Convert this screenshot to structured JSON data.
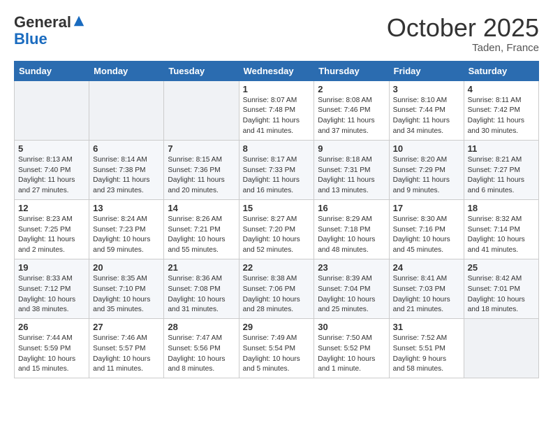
{
  "header": {
    "logo_line1": "General",
    "logo_line2": "Blue",
    "month": "October 2025",
    "location": "Taden, France"
  },
  "weekdays": [
    "Sunday",
    "Monday",
    "Tuesday",
    "Wednesday",
    "Thursday",
    "Friday",
    "Saturday"
  ],
  "weeks": [
    [
      {
        "day": "",
        "info": ""
      },
      {
        "day": "",
        "info": ""
      },
      {
        "day": "",
        "info": ""
      },
      {
        "day": "1",
        "info": "Sunrise: 8:07 AM\nSunset: 7:48 PM\nDaylight: 11 hours\nand 41 minutes."
      },
      {
        "day": "2",
        "info": "Sunrise: 8:08 AM\nSunset: 7:46 PM\nDaylight: 11 hours\nand 37 minutes."
      },
      {
        "day": "3",
        "info": "Sunrise: 8:10 AM\nSunset: 7:44 PM\nDaylight: 11 hours\nand 34 minutes."
      },
      {
        "day": "4",
        "info": "Sunrise: 8:11 AM\nSunset: 7:42 PM\nDaylight: 11 hours\nand 30 minutes."
      }
    ],
    [
      {
        "day": "5",
        "info": "Sunrise: 8:13 AM\nSunset: 7:40 PM\nDaylight: 11 hours\nand 27 minutes."
      },
      {
        "day": "6",
        "info": "Sunrise: 8:14 AM\nSunset: 7:38 PM\nDaylight: 11 hours\nand 23 minutes."
      },
      {
        "day": "7",
        "info": "Sunrise: 8:15 AM\nSunset: 7:36 PM\nDaylight: 11 hours\nand 20 minutes."
      },
      {
        "day": "8",
        "info": "Sunrise: 8:17 AM\nSunset: 7:33 PM\nDaylight: 11 hours\nand 16 minutes."
      },
      {
        "day": "9",
        "info": "Sunrise: 8:18 AM\nSunset: 7:31 PM\nDaylight: 11 hours\nand 13 minutes."
      },
      {
        "day": "10",
        "info": "Sunrise: 8:20 AM\nSunset: 7:29 PM\nDaylight: 11 hours\nand 9 minutes."
      },
      {
        "day": "11",
        "info": "Sunrise: 8:21 AM\nSunset: 7:27 PM\nDaylight: 11 hours\nand 6 minutes."
      }
    ],
    [
      {
        "day": "12",
        "info": "Sunrise: 8:23 AM\nSunset: 7:25 PM\nDaylight: 11 hours\nand 2 minutes."
      },
      {
        "day": "13",
        "info": "Sunrise: 8:24 AM\nSunset: 7:23 PM\nDaylight: 10 hours\nand 59 minutes."
      },
      {
        "day": "14",
        "info": "Sunrise: 8:26 AM\nSunset: 7:21 PM\nDaylight: 10 hours\nand 55 minutes."
      },
      {
        "day": "15",
        "info": "Sunrise: 8:27 AM\nSunset: 7:20 PM\nDaylight: 10 hours\nand 52 minutes."
      },
      {
        "day": "16",
        "info": "Sunrise: 8:29 AM\nSunset: 7:18 PM\nDaylight: 10 hours\nand 48 minutes."
      },
      {
        "day": "17",
        "info": "Sunrise: 8:30 AM\nSunset: 7:16 PM\nDaylight: 10 hours\nand 45 minutes."
      },
      {
        "day": "18",
        "info": "Sunrise: 8:32 AM\nSunset: 7:14 PM\nDaylight: 10 hours\nand 41 minutes."
      }
    ],
    [
      {
        "day": "19",
        "info": "Sunrise: 8:33 AM\nSunset: 7:12 PM\nDaylight: 10 hours\nand 38 minutes."
      },
      {
        "day": "20",
        "info": "Sunrise: 8:35 AM\nSunset: 7:10 PM\nDaylight: 10 hours\nand 35 minutes."
      },
      {
        "day": "21",
        "info": "Sunrise: 8:36 AM\nSunset: 7:08 PM\nDaylight: 10 hours\nand 31 minutes."
      },
      {
        "day": "22",
        "info": "Sunrise: 8:38 AM\nSunset: 7:06 PM\nDaylight: 10 hours\nand 28 minutes."
      },
      {
        "day": "23",
        "info": "Sunrise: 8:39 AM\nSunset: 7:04 PM\nDaylight: 10 hours\nand 25 minutes."
      },
      {
        "day": "24",
        "info": "Sunrise: 8:41 AM\nSunset: 7:03 PM\nDaylight: 10 hours\nand 21 minutes."
      },
      {
        "day": "25",
        "info": "Sunrise: 8:42 AM\nSunset: 7:01 PM\nDaylight: 10 hours\nand 18 minutes."
      }
    ],
    [
      {
        "day": "26",
        "info": "Sunrise: 7:44 AM\nSunset: 5:59 PM\nDaylight: 10 hours\nand 15 minutes."
      },
      {
        "day": "27",
        "info": "Sunrise: 7:46 AM\nSunset: 5:57 PM\nDaylight: 10 hours\nand 11 minutes."
      },
      {
        "day": "28",
        "info": "Sunrise: 7:47 AM\nSunset: 5:56 PM\nDaylight: 10 hours\nand 8 minutes."
      },
      {
        "day": "29",
        "info": "Sunrise: 7:49 AM\nSunset: 5:54 PM\nDaylight: 10 hours\nand 5 minutes."
      },
      {
        "day": "30",
        "info": "Sunrise: 7:50 AM\nSunset: 5:52 PM\nDaylight: 10 hours\nand 1 minute."
      },
      {
        "day": "31",
        "info": "Sunrise: 7:52 AM\nSunset: 5:51 PM\nDaylight: 9 hours\nand 58 minutes."
      },
      {
        "day": "",
        "info": ""
      }
    ]
  ]
}
